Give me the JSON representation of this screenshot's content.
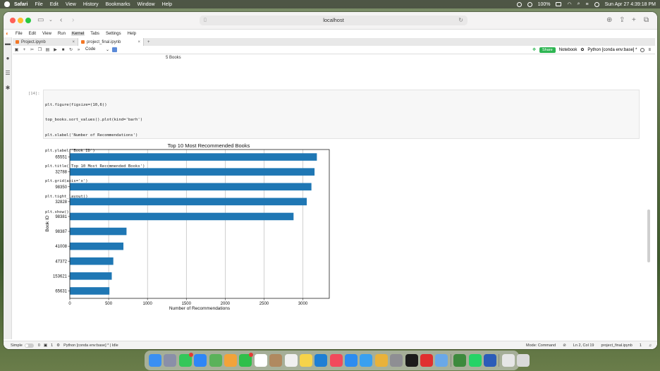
{
  "menubar": {
    "app": "Safari",
    "items": [
      "File",
      "Edit",
      "View",
      "History",
      "Bookmarks",
      "Window",
      "Help"
    ],
    "battery": "100%",
    "datetime": "Sun Apr 27  4:39:18 PM"
  },
  "browser": {
    "url": "localhost"
  },
  "jupyter": {
    "menu": [
      "File",
      "Edit",
      "View",
      "Run",
      "Kernel",
      "Tabs",
      "Settings",
      "Help"
    ],
    "active_menu": "Kernel",
    "tabs": [
      {
        "label": "Project.ipynb"
      },
      {
        "label": "project_final.ipynb"
      }
    ],
    "cell_type": "Code",
    "share_label": "Share",
    "notebook_label": "Notebook",
    "kernel_label": "Python [conda env:base] *"
  },
  "notebook": {
    "prev_output": "5 Books",
    "cell_prompt": "[14]:",
    "code_lines": [
      "plt.figure(figsize=(10,6))",
      "top_books.sort_values().plot(kind='barh')",
      "plt.xlabel('Number of Recommendations')",
      "plt.ylabel('Book ID')",
      "plt.title('Top 10 Most Recommended Books')",
      "plt.grid(axis='x')",
      "plt.tight_layout()",
      "plt.show()"
    ]
  },
  "chart_data": {
    "type": "bar",
    "orientation": "horizontal",
    "title": "Top 10 Most Recommended Books",
    "xlabel": "Number of Recommendations",
    "ylabel": "Book ID",
    "categories": [
      "65551",
      "32788",
      "98350",
      "32828",
      "98381",
      "98387",
      "41008",
      "47372",
      "153621",
      "65631"
    ],
    "values": [
      3180,
      3150,
      3110,
      3050,
      2880,
      730,
      690,
      560,
      540,
      510
    ],
    "xticks": [
      0,
      500,
      1000,
      1500,
      2000,
      2500,
      3000
    ],
    "xlim": [
      0,
      3340
    ],
    "grid": "x",
    "bar_color": "#1f77b4"
  },
  "statusbar": {
    "mode_label": "Simple",
    "count_a": "0",
    "count_b": "1",
    "kernel_status": "Python [conda env:base] * | Idle",
    "command_mode": "Mode: Command",
    "cursor_pos": "Ln 2, Col 19",
    "file_name": "project_final.ipynb",
    "line_count": "1"
  },
  "dock": {
    "icons": [
      {
        "name": "finder",
        "color": "#3b8ff2"
      },
      {
        "name": "launchpad",
        "color": "#8a8fa8"
      },
      {
        "name": "messages",
        "color": "#34c759",
        "badge": true
      },
      {
        "name": "mail",
        "color": "#2f86f6"
      },
      {
        "name": "maps",
        "color": "#5ab25a"
      },
      {
        "name": "photos",
        "color": "#f2a33a"
      },
      {
        "name": "facetime",
        "color": "#2fbf4a",
        "badge": true
      },
      {
        "name": "calendar",
        "color": "#ffffff"
      },
      {
        "name": "contacts",
        "color": "#b08960"
      },
      {
        "name": "reminders",
        "color": "#f0f0f0"
      },
      {
        "name": "notes",
        "color": "#f6d34a"
      },
      {
        "name": "vscode",
        "color": "#1f7fd4"
      },
      {
        "name": "music",
        "color": "#f24a5c"
      },
      {
        "name": "app-store",
        "color": "#2d8cf0"
      },
      {
        "name": "safari",
        "color": "#3aa0f0"
      },
      {
        "name": "chrome",
        "color": "#e9b23a"
      },
      {
        "name": "settings",
        "color": "#8e8e93"
      },
      {
        "name": "pycharm",
        "color": "#1b1b1b"
      },
      {
        "name": "youtube",
        "color": "#e02f2f"
      },
      {
        "name": "preview",
        "color": "#6aa8e8"
      },
      {
        "name": "sep"
      },
      {
        "name": "android-studio",
        "color": "#3d8a3d"
      },
      {
        "name": "whatsapp",
        "color": "#25d366"
      },
      {
        "name": "word",
        "color": "#2b5cb8"
      },
      {
        "name": "sep"
      },
      {
        "name": "downloads",
        "color": "#e6e6e6"
      },
      {
        "name": "trash",
        "color": "#d9d9d9"
      }
    ]
  }
}
